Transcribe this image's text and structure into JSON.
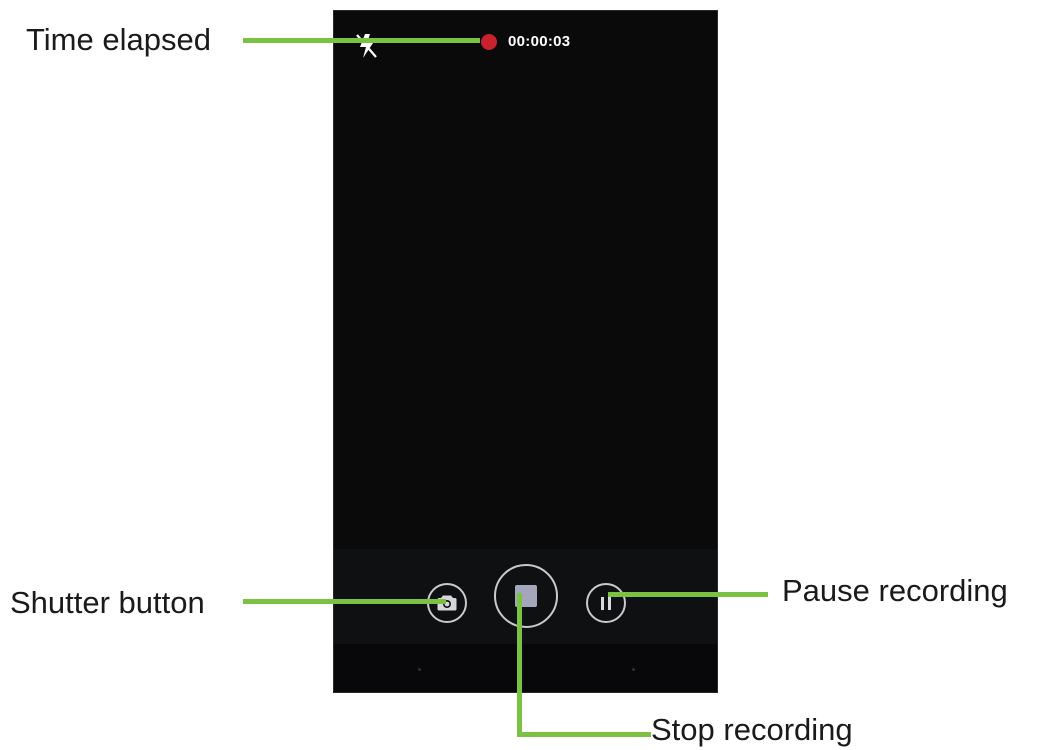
{
  "recorder": {
    "timer": "00:00:03",
    "status_color": "#c8232c",
    "flash_icon": "flash-off-icon",
    "shutter_icon": "camera-icon",
    "stop_icon": "stop-icon",
    "pause_icon": "pause-icon"
  },
  "callouts": {
    "time_elapsed": "Time elapsed",
    "shutter_button": "Shutter button",
    "pause_recording": "Pause recording",
    "stop_recording": "Stop recording"
  },
  "colors": {
    "callout_line": "#7bc142",
    "screen_background": "#0a0a0b",
    "control_outline": "#c9c9cf",
    "stop_fill": "#a4a7bc"
  }
}
